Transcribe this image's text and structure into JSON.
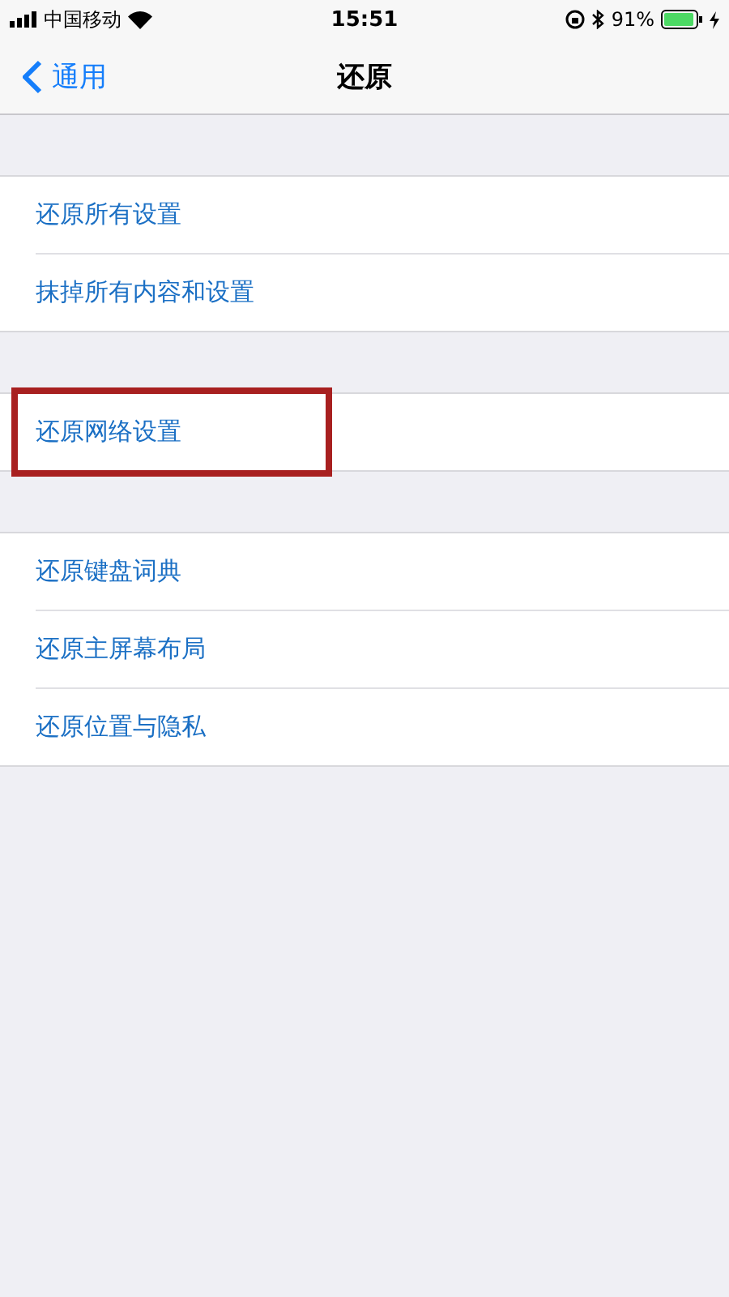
{
  "status_bar": {
    "carrier": "中国移动",
    "time": "15:51",
    "battery": "91%"
  },
  "nav": {
    "back": "通用",
    "title": "还原"
  },
  "groups": [
    {
      "items": [
        {
          "label": "还原所有设置",
          "highlighted": false
        },
        {
          "label": "抹掉所有内容和设置",
          "highlighted": false
        }
      ]
    },
    {
      "items": [
        {
          "label": "还原网络设置",
          "highlighted": true
        }
      ]
    },
    {
      "items": [
        {
          "label": "还原键盘词典",
          "highlighted": false
        },
        {
          "label": "还原主屏幕布局",
          "highlighted": false
        },
        {
          "label": "还原位置与隐私",
          "highlighted": false
        }
      ]
    }
  ]
}
